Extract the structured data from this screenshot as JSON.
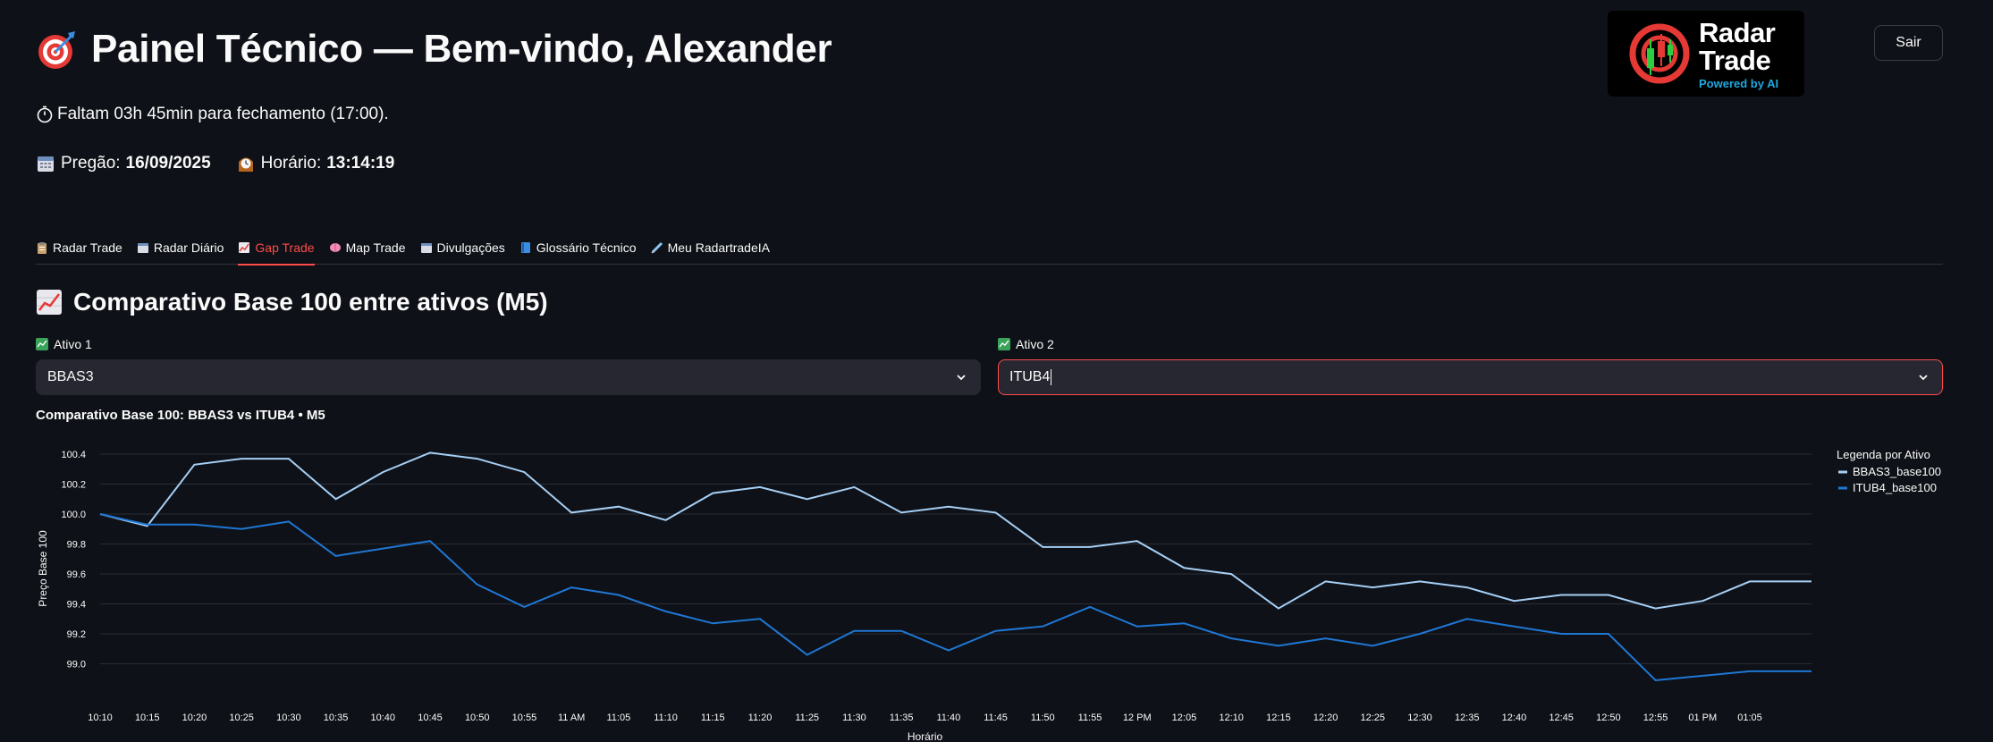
{
  "header": {
    "title": "Painel Técnico — Bem-vindo, Alexander",
    "logout_label": "Sair",
    "logo": {
      "word1": "Radar",
      "word2": "Trade",
      "tagline": "Powered by AI"
    }
  },
  "status": {
    "countdown": "Faltam 03h 45min para fechamento (17:00).",
    "session_label": "Pregão:",
    "session_date": "16/09/2025",
    "time_label": "Horário:",
    "time_value": "13:14:19"
  },
  "tabs": [
    {
      "label": "Radar Trade",
      "active": false
    },
    {
      "label": "Radar Diário",
      "active": false
    },
    {
      "label": "Gap Trade",
      "active": true
    },
    {
      "label": "Map Trade",
      "active": false
    },
    {
      "label": "Divulgações",
      "active": false
    },
    {
      "label": "Glossário Técnico",
      "active": false
    },
    {
      "label": "Meu RadartradeIA",
      "active": false
    }
  ],
  "section": {
    "title": "Comparativo Base 100 entre ativos (M5)"
  },
  "selectors": {
    "asset1_label": "Ativo 1",
    "asset1_value": "BBAS3",
    "asset2_label": "Ativo 2",
    "asset2_value": "ITUB4"
  },
  "colors": {
    "accent": "#ff4b4b",
    "series1": "#a6cff5",
    "series2": "#1f77d4",
    "background": "#0e1117"
  },
  "chart_data": {
    "type": "line",
    "title": "Comparativo Base 100: BBAS3 vs ITUB4 • M5",
    "xlabel": "Horário",
    "ylabel": "Preço Base 100",
    "ylim": [
      98.86,
      100.46
    ],
    "yticks": [
      99.0,
      99.2,
      99.4,
      99.6,
      99.8,
      100.0,
      100.2,
      100.4
    ],
    "grid": true,
    "legend_title": "Legenda por Ativo",
    "legend_position": "right",
    "x": [
      "10:10",
      "10:15",
      "10:20",
      "10:25",
      "10:30",
      "10:35",
      "10:40",
      "10:45",
      "10:50",
      "10:55",
      "11 AM",
      "11:05",
      "11:10",
      "11:15",
      "11:20",
      "11:25",
      "11:30",
      "11:35",
      "11:40",
      "11:45",
      "11:50",
      "11:55",
      "12 PM",
      "12:05",
      "12:10",
      "12:15",
      "12:20",
      "12:25",
      "12:30",
      "12:35",
      "12:40",
      "12:45",
      "12:50",
      "12:55",
      "01 PM",
      "01:05"
    ],
    "series": [
      {
        "name": "BBAS3_base100",
        "color": "#a6cff5",
        "values": [
          100.0,
          99.92,
          100.33,
          100.37,
          100.37,
          100.1,
          100.28,
          100.41,
          100.37,
          100.28,
          100.01,
          100.05,
          99.96,
          100.14,
          100.18,
          100.1,
          100.18,
          100.01,
          100.05,
          100.01,
          99.78,
          99.78,
          99.82,
          99.64,
          99.6,
          99.37,
          99.55,
          99.51,
          99.55,
          99.51,
          99.42,
          99.46,
          99.46,
          99.37,
          99.42,
          99.55,
          99.55
        ]
      },
      {
        "name": "ITUB4_base100",
        "color": "#1f77d4",
        "values": [
          100.0,
          99.93,
          99.93,
          99.9,
          99.95,
          99.72,
          99.77,
          99.82,
          99.53,
          99.38,
          99.51,
          99.46,
          99.35,
          99.27,
          99.3,
          99.06,
          99.22,
          99.22,
          99.09,
          99.22,
          99.25,
          99.38,
          99.25,
          99.27,
          99.17,
          99.12,
          99.17,
          99.12,
          99.2,
          99.3,
          99.25,
          99.2,
          99.2,
          98.89,
          98.92,
          98.95,
          98.95
        ]
      }
    ]
  }
}
